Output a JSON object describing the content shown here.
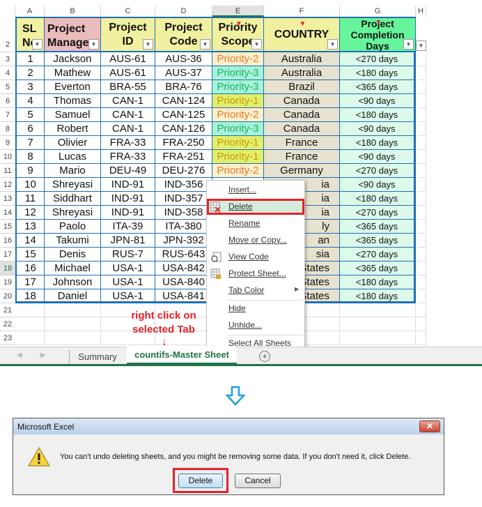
{
  "columns": [
    "A",
    "B",
    "C",
    "D",
    "E",
    "F",
    "G",
    "H"
  ],
  "selected_column": "E",
  "headers": [
    "SL No",
    "Project Manager",
    "Project ID",
    "Project Code",
    "Priority Scope",
    "COUNTRY",
    "Project Completion Days"
  ],
  "header_lines": [
    [
      "SL",
      "N"
    ],
    [
      "Project",
      "Manage"
    ],
    [
      "Project",
      "ID"
    ],
    [
      "Project",
      "Code"
    ],
    [
      "Priority",
      "Scope"
    ],
    [
      "COUNTRY"
    ],
    [
      "Project",
      "Completion",
      "Days"
    ]
  ],
  "rows": [
    [
      "1",
      "Jackson",
      "AUS-61",
      "AUS-36",
      "Priority-2",
      "Australia",
      "<270 days"
    ],
    [
      "2",
      "Mathew",
      "AUS-61",
      "AUS-37",
      "Priority-3",
      "Australia",
      "<180 days"
    ],
    [
      "3",
      "Everton",
      "BRA-55",
      "BRA-76",
      "Priority-3",
      "Brazil",
      "<365 days"
    ],
    [
      "4",
      "Thomas",
      "CAN-1",
      "CAN-124",
      "Priority-1",
      "Canada",
      "<90 days"
    ],
    [
      "5",
      "Samuel",
      "CAN-1",
      "CAN-125",
      "Priority-2",
      "Canada",
      "<180 days"
    ],
    [
      "6",
      "Robert",
      "CAN-1",
      "CAN-126",
      "Priority-3",
      "Canada",
      "<90 days"
    ],
    [
      "7",
      "Olivier",
      "FRA-33",
      "FRA-250",
      "Priority-1",
      "France",
      "<180 days"
    ],
    [
      "8",
      "Lucas",
      "FRA-33",
      "FRA-251",
      "Priority-1",
      "France",
      "<90 days"
    ],
    [
      "9",
      "Mario",
      "DEU-49",
      "DEU-276",
      "Priority-2",
      "Germany",
      "<270 days"
    ],
    [
      "10",
      "Shreyasi",
      "IND-91",
      "IND-356",
      "",
      "ia",
      "<90 days"
    ],
    [
      "11",
      "Siddhart",
      "IND-91",
      "IND-357",
      "",
      "ia",
      "<180 days"
    ],
    [
      "12",
      "Shreyasi",
      "IND-91",
      "IND-358",
      "",
      "ia",
      "<270 days"
    ],
    [
      "13",
      "Paolo",
      "ITA-39",
      "ITA-380",
      "",
      "ly",
      "<365 days"
    ],
    [
      "14",
      "Takumi",
      "JPN-81",
      "JPN-392",
      "",
      "an",
      "<365 days"
    ],
    [
      "15",
      "Denis",
      "RUS-7",
      "RUS-643",
      "",
      "sia",
      "<270 days"
    ],
    [
      "16",
      "Michael",
      "USA-1",
      "USA-842",
      "",
      "States",
      "<365 days"
    ],
    [
      "17",
      "Johnson",
      "USA-1",
      "USA-840",
      "",
      "States",
      "<180 days"
    ],
    [
      "18",
      "Daniel",
      "USA-1",
      "USA-841",
      "",
      "States",
      "<180 days"
    ]
  ],
  "row_numbers": [
    "2",
    "3",
    "4",
    "5",
    "6",
    "7",
    "8",
    "9",
    "10",
    "11",
    "12",
    "13",
    "14",
    "15",
    "16",
    "17",
    "18",
    "19",
    "20",
    "21",
    "22",
    "23"
  ],
  "selected_row": "18",
  "colors": {
    "header_yellow": "#f0f0a0",
    "header_pink": "#ebbcbc",
    "header_green": "#66f59a",
    "p1_bg": "#e2ef6c",
    "p1_fg": "#c79a00",
    "p2_bg": "#fdf0cc",
    "p2_fg": "#e8772a",
    "p3_bg": "#a6f3d6",
    "p3_fg": "#1fae6c",
    "country_bg": "#e6e2cf",
    "days_bg": "#dcfaea",
    "grid_blue": "#1f6fb5",
    "excel_green": "#217346",
    "annotation_red": "#e8202a"
  },
  "context_menu": {
    "items": [
      {
        "label": "Insert...",
        "icon": ""
      },
      {
        "label": "Delete",
        "icon": "delete-sheet-icon",
        "highlighted": true
      },
      {
        "label": "Rename",
        "icon": ""
      },
      {
        "label": "Move or Copy...",
        "icon": ""
      },
      {
        "label": "View Code",
        "icon": "view-code-icon"
      },
      {
        "label": "Protect Sheet...",
        "icon": "protect-sheet-icon"
      },
      {
        "label": "Tab Color",
        "icon": "",
        "submenu": true
      },
      {
        "label": "Hide",
        "icon": ""
      },
      {
        "label": "Unhide...",
        "icon": ""
      },
      {
        "label": "Select All Sheets",
        "icon": ""
      }
    ]
  },
  "annotation": {
    "line1": "right click on",
    "line2": "selected Tab"
  },
  "tabs": {
    "items": [
      "Summary",
      "countifs-Master Sheet"
    ],
    "active": "countifs-Master Sheet"
  },
  "dialog": {
    "title": "Microsoft Excel",
    "message": "You can't undo deleting sheets, and you might be removing some data. If you don't need it, click Delete.",
    "delete_label": "Delete",
    "cancel_label": "Cancel",
    "icon": "warning-icon"
  }
}
